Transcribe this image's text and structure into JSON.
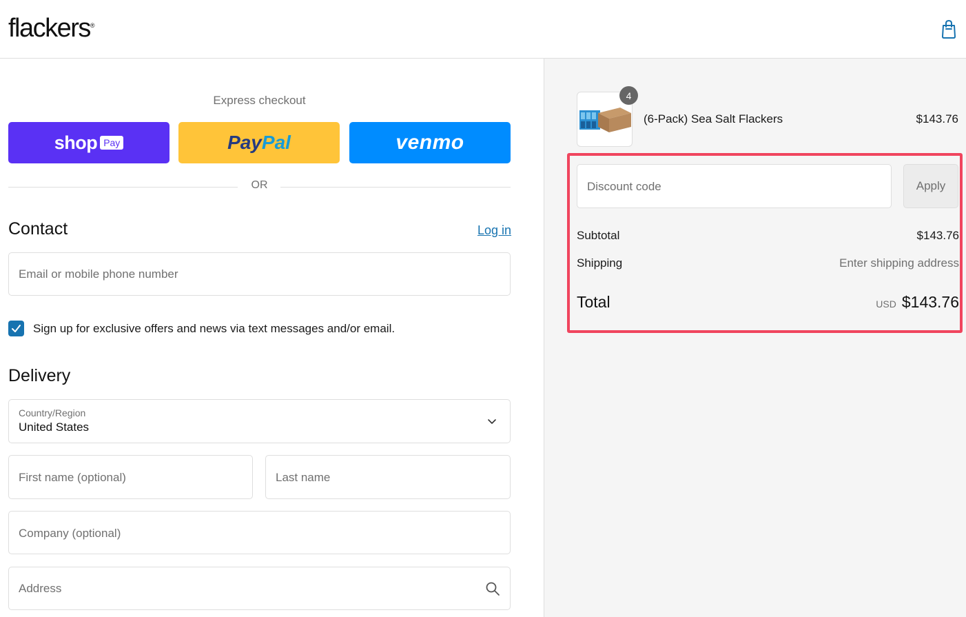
{
  "header": {
    "logo": "flackers",
    "logo_mark": "®",
    "cart_icon": "shopping-bag-icon"
  },
  "express": {
    "title": "Express checkout",
    "shop_word": "shop",
    "shop_pay": "Pay",
    "paypal_part1": "Pay",
    "paypal_part2": "Pal",
    "venmo": "venmo",
    "or": "OR"
  },
  "contact": {
    "title": "Contact",
    "login": "Log in",
    "email_placeholder": "Email or mobile phone number",
    "signup_checked": true,
    "signup_label": "Sign up for exclusive offers and news via text messages and/or email."
  },
  "delivery": {
    "title": "Delivery",
    "country_label": "Country/Region",
    "country_value": "United States",
    "first_name_placeholder": "First name (optional)",
    "last_name_placeholder": "Last name",
    "company_placeholder": "Company (optional)",
    "address_placeholder": "Address"
  },
  "summary": {
    "item": {
      "quantity": "4",
      "name": "(6-Pack) Sea Salt Flackers",
      "price": "$143.76"
    },
    "discount_placeholder": "Discount code",
    "apply_label": "Apply",
    "subtotal_label": "Subtotal",
    "subtotal_value": "$143.76",
    "shipping_label": "Shipping",
    "shipping_value": "Enter shipping address",
    "total_label": "Total",
    "currency": "USD",
    "total_value": "$143.76"
  },
  "colors": {
    "shop_pay": "#5a31f4",
    "paypal": "#ffc439",
    "venmo": "#008cff",
    "link": "#1773b0",
    "highlight": "#f0455e"
  }
}
